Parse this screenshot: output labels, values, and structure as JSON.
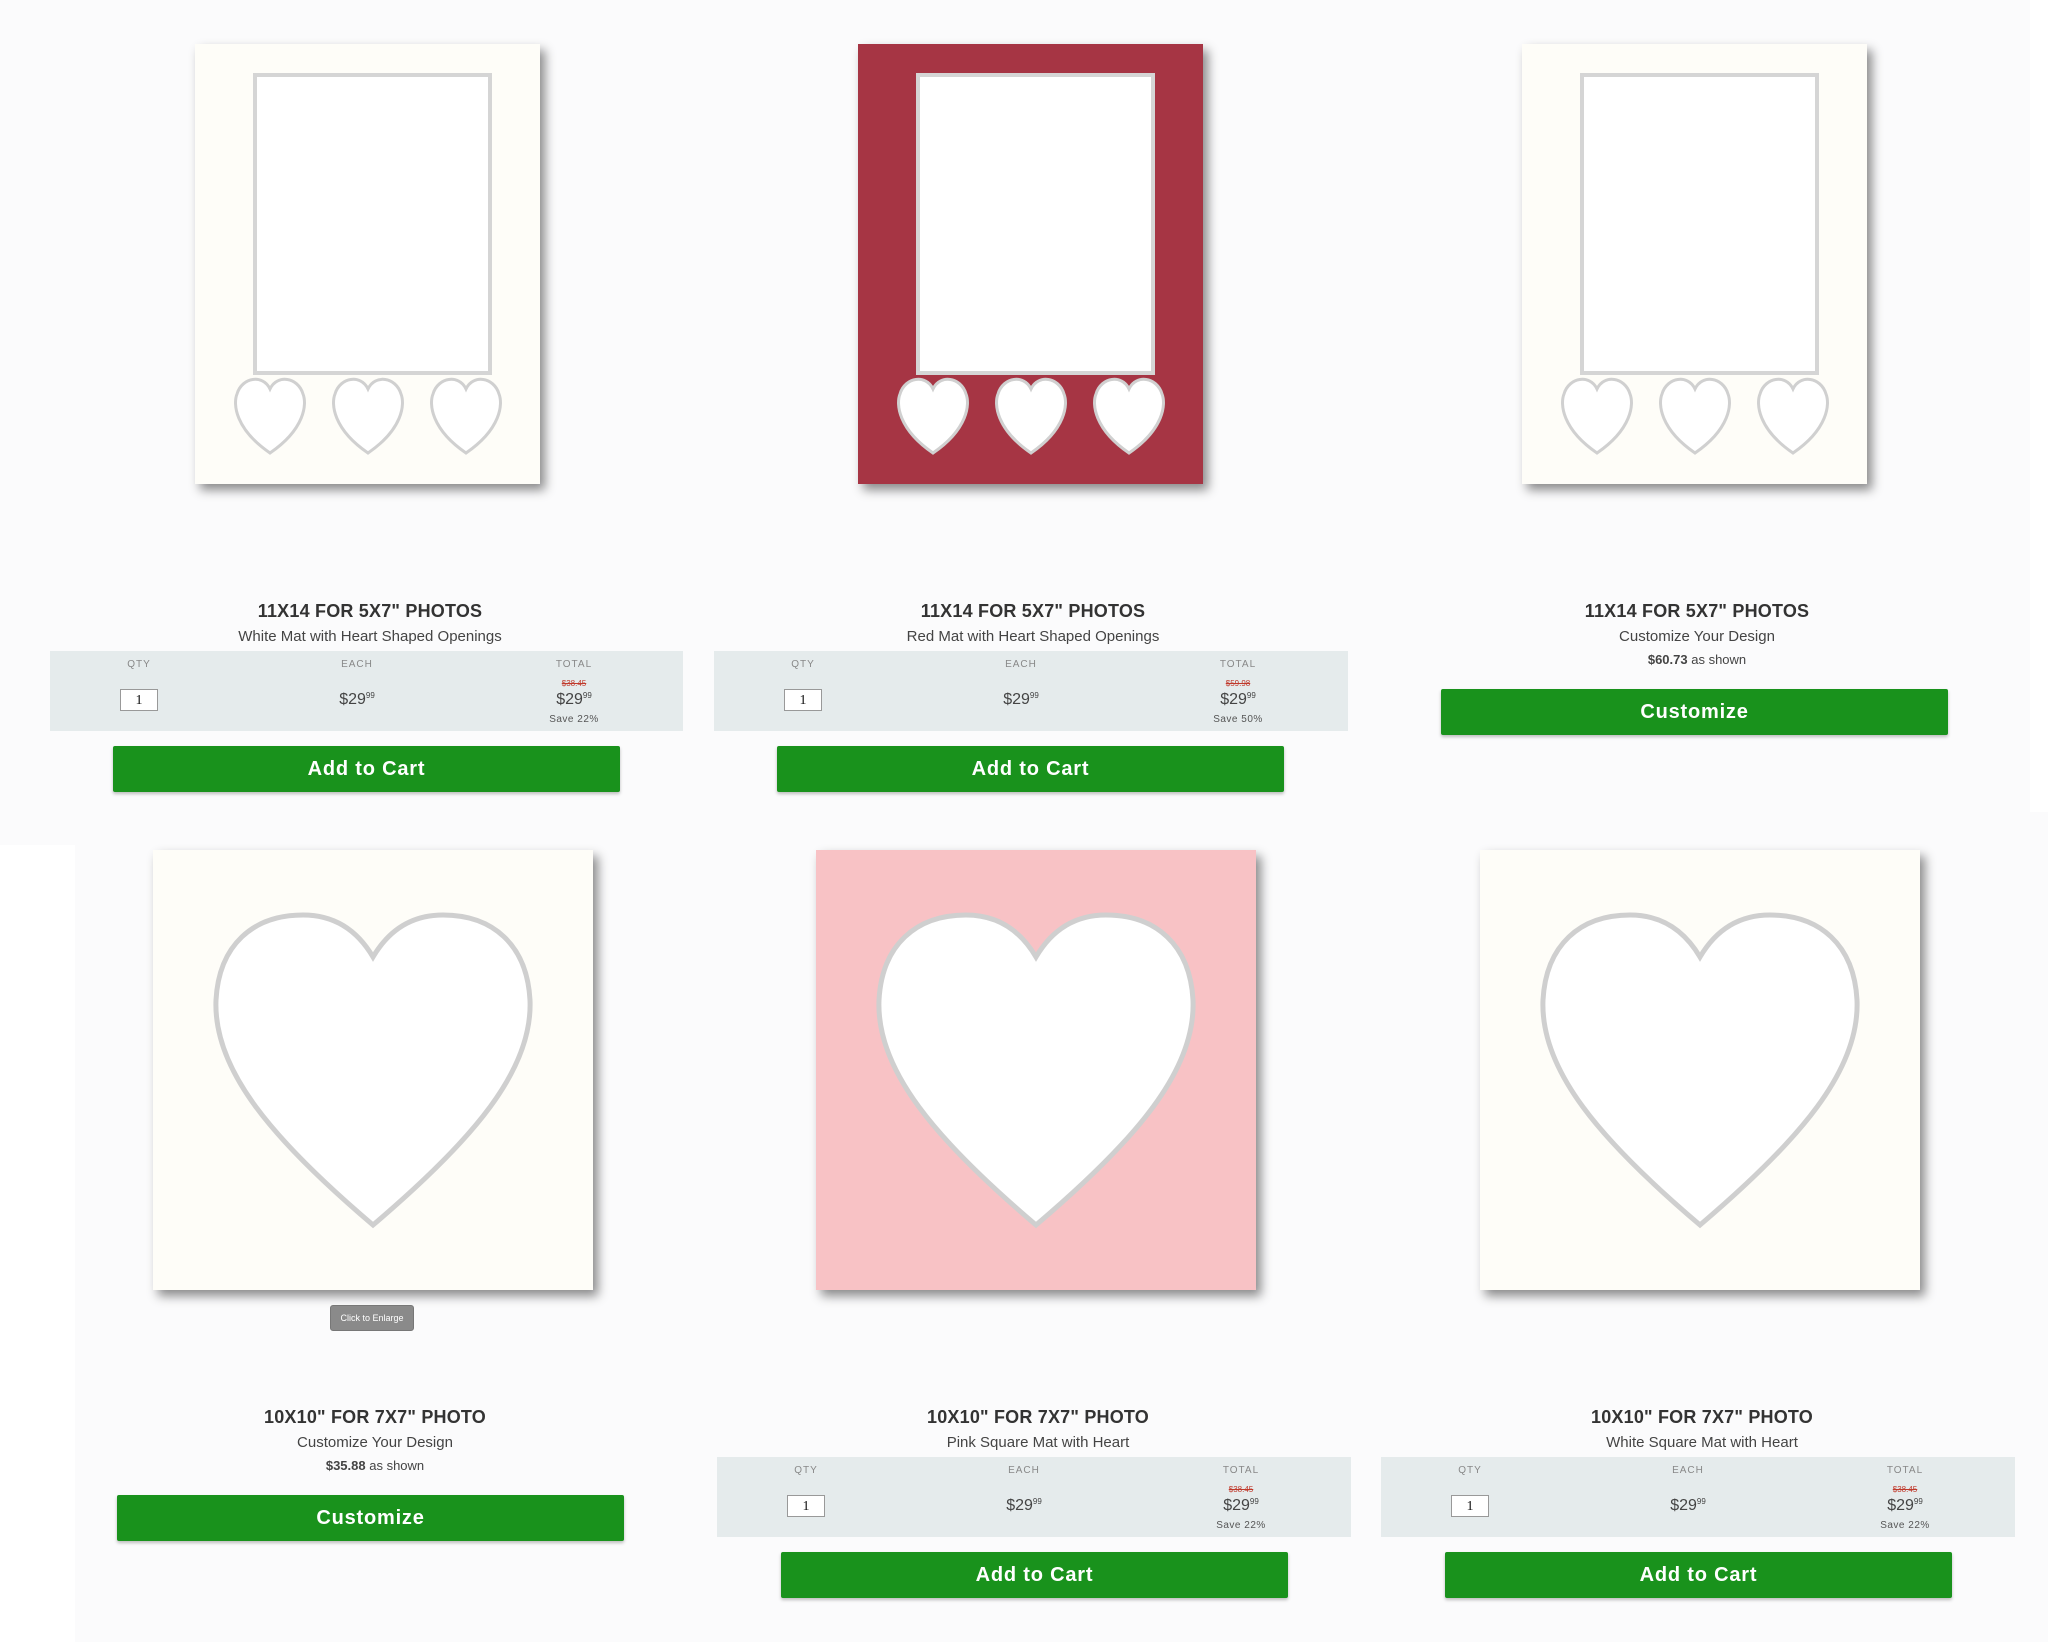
{
  "products": [
    {
      "id": "p1",
      "title": "11X14 FOR 5X7\" PHOTOS",
      "subtitle": "White Mat with Heart Shaped Openings",
      "mat_color": "#fefdf8",
      "qty_label": "QTY",
      "each_label": "EACH",
      "total_label": "TOTAL",
      "qty": "1",
      "each_price": "$29",
      "each_cents": "99",
      "old_total": "$38.45",
      "total_price": "$29",
      "total_cents": "99",
      "save_text": "Save 22%",
      "button_label": "Add to Cart"
    },
    {
      "id": "p2",
      "title": "11X14 FOR 5X7\" PHOTOS",
      "subtitle": "Red Mat with Heart Shaped Openings",
      "mat_color": "#a63544",
      "qty_label": "QTY",
      "each_label": "EACH",
      "total_label": "TOTAL",
      "qty": "1",
      "each_price": "$29",
      "each_cents": "99",
      "old_total": "$59.98",
      "total_price": "$29",
      "total_cents": "99",
      "save_text": "Save 50%",
      "button_label": "Add to Cart"
    },
    {
      "id": "p3",
      "title": "11X14 FOR 5X7\" PHOTOS",
      "subtitle": "Customize Your Design",
      "mat_color": "#fefdf8",
      "as_shown_price": "$60.73",
      "as_shown_suffix": " as shown",
      "button_label": "Customize"
    },
    {
      "id": "p4",
      "title": "10X10\" FOR 7X7\" PHOTO",
      "subtitle": "Customize Your Design",
      "mat_color": "#fefdf8",
      "as_shown_price": "$35.88",
      "as_shown_suffix": " as shown",
      "enlarge_label": "Click to Enlarge",
      "button_label": "Customize"
    },
    {
      "id": "p5",
      "title": "10X10\" FOR 7X7\" PHOTO",
      "subtitle": "Pink Square Mat with Heart",
      "mat_color": "#f8c2c5",
      "qty_label": "QTY",
      "each_label": "EACH",
      "total_label": "TOTAL",
      "qty": "1",
      "each_price": "$29",
      "each_cents": "99",
      "old_total": "$38.45",
      "total_price": "$29",
      "total_cents": "99",
      "save_text": "Save 22%",
      "button_label": "Add to Cart"
    },
    {
      "id": "p6",
      "title": "10X10\" FOR 7X7\" PHOTO",
      "subtitle": "White Square Mat with Heart",
      "mat_color": "#fefdf8",
      "qty_label": "QTY",
      "each_label": "EACH",
      "total_label": "TOTAL",
      "qty": "1",
      "each_price": "$29",
      "each_cents": "99",
      "old_total": "$38.45",
      "total_price": "$29",
      "total_cents": "99",
      "save_text": "Save 22%",
      "button_label": "Add to Cart"
    }
  ],
  "colors": {
    "button_green": "#19921c",
    "price_box_bg": "#e5ebec",
    "strike_red": "#c0392b"
  }
}
